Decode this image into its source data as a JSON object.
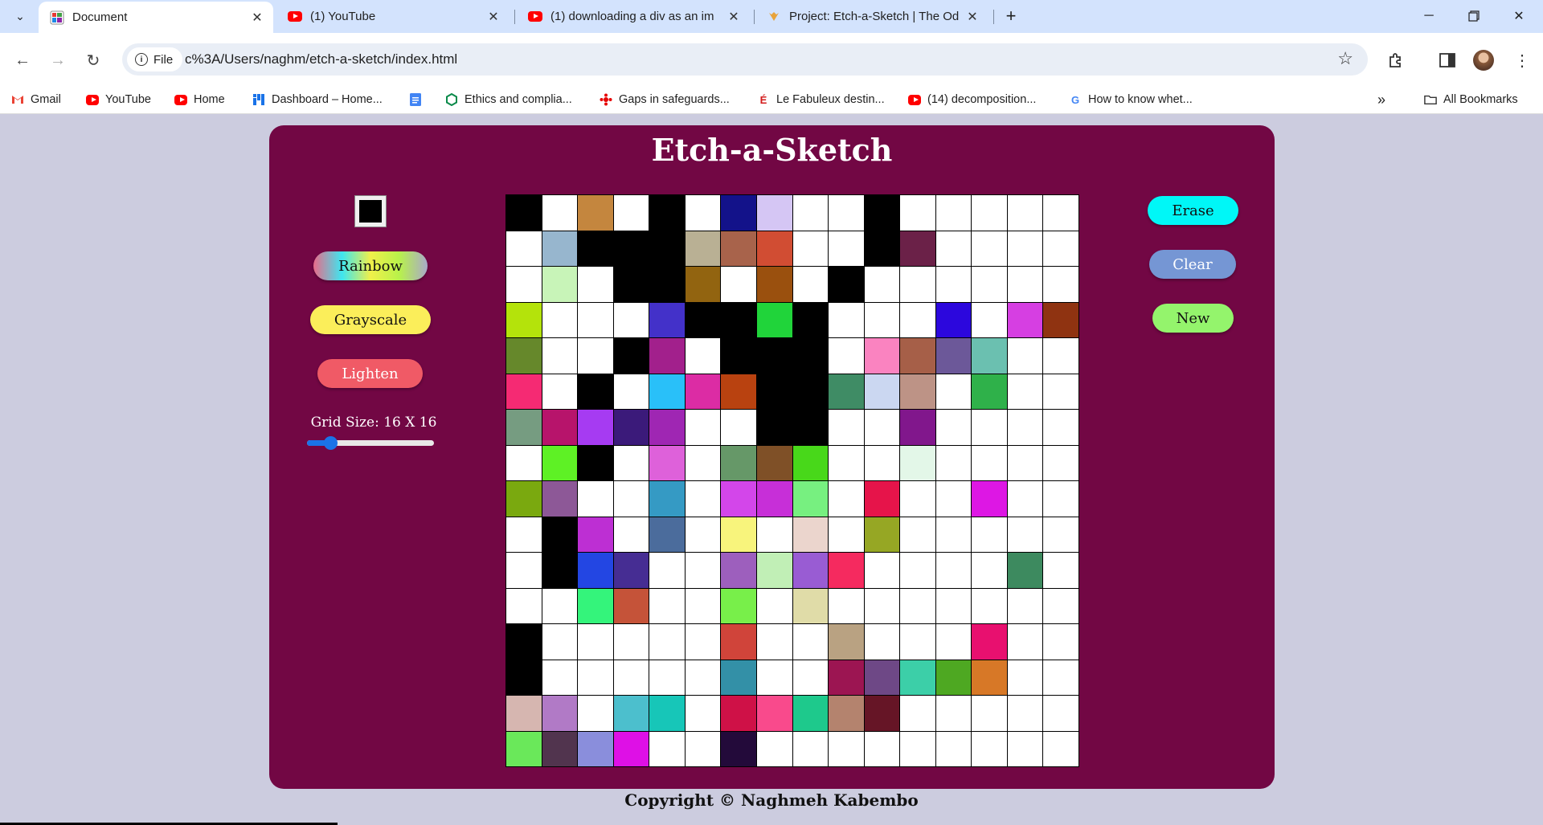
{
  "browser": {
    "tabs": [
      {
        "title": "Document",
        "active": true,
        "icon": "page-favicon"
      },
      {
        "title": "(1) YouTube",
        "active": false,
        "icon": "youtube-favicon"
      },
      {
        "title": "(1) downloading a div as an im",
        "active": false,
        "icon": "youtube-favicon"
      },
      {
        "title": "Project: Etch-a-Sketch | The Od",
        "active": false,
        "icon": "odin-favicon"
      }
    ],
    "file_label": "File",
    "url": "c%3A/Users/naghm/etch-a-sketch/index.html",
    "bookmarks": [
      {
        "label": "Gmail",
        "icon": "gmail-icon"
      },
      {
        "label": "YouTube",
        "icon": "youtube-icon"
      },
      {
        "label": "Home",
        "icon": "youtube-icon"
      },
      {
        "label": "Dashboard – Home...",
        "icon": "dashboard-icon"
      },
      {
        "label": "",
        "icon": "docs-icon"
      },
      {
        "label": "Ethics and complia...",
        "icon": "hexagon-icon"
      },
      {
        "label": "Gaps in safeguards...",
        "icon": "cbc-icon"
      },
      {
        "label": "Le Fabuleux destin...",
        "icon": "e-icon"
      },
      {
        "label": "(14) decomposition...",
        "icon": "youtube-icon"
      },
      {
        "label": "How to know whet...",
        "icon": "google-icon"
      }
    ],
    "all_bookmarks": "All Bookmarks"
  },
  "app": {
    "title": "Etch-a-Sketch",
    "current_color": "#000000",
    "buttons": {
      "rainbow": "Rainbow",
      "grayscale": "Grayscale",
      "lighten": "Lighten",
      "erase": "Erase",
      "clear": "Clear",
      "new": "New"
    },
    "grid_size_label": "Grid Size: 16 X 16",
    "grid_size_value": 16,
    "slider_min": 1,
    "slider_max": 100,
    "grid": [
      [
        "#000000",
        "#ffffff",
        "#c4863e",
        "#ffffff",
        "#000000",
        "#ffffff",
        "#13128a",
        "#d5c6f4",
        "#ffffff",
        "#ffffff",
        "#000000",
        "#ffffff",
        "#ffffff",
        "#ffffff",
        "#ffffff",
        "#ffffff"
      ],
      [
        "#ffffff",
        "#97b6ce",
        "#000000",
        "#000000",
        "#000000",
        "#b9b094",
        "#a8634b",
        "#d14d33",
        "#ffffff",
        "#ffffff",
        "#000000",
        "#6b2148",
        "#ffffff",
        "#ffffff",
        "#ffffff",
        "#ffffff"
      ],
      [
        "#ffffff",
        "#c8f4b8",
        "#ffffff",
        "#000000",
        "#000000",
        "#926410",
        "#ffffff",
        "#9a500e",
        "#ffffff",
        "#000000",
        "#ffffff",
        "#ffffff",
        "#ffffff",
        "#ffffff",
        "#ffffff",
        "#ffffff"
      ],
      [
        "#b4e30b",
        "#ffffff",
        "#ffffff",
        "#ffffff",
        "#4331c9",
        "#000000",
        "#000000",
        "#20d43a",
        "#000000",
        "#ffffff",
        "#ffffff",
        "#ffffff",
        "#2c07dd",
        "#ffffff",
        "#d63fe2",
        "#8f3311"
      ],
      [
        "#66882b",
        "#ffffff",
        "#ffffff",
        "#000000",
        "#a2208c",
        "#ffffff",
        "#000000",
        "#000000",
        "#000000",
        "#ffffff",
        "#fa83c0",
        "#a65f48",
        "#6c5899",
        "#6bc0b0",
        "#ffffff",
        "#ffffff"
      ],
      [
        "#f52a73",
        "#ffffff",
        "#000000",
        "#ffffff",
        "#29c0f9",
        "#dc2ca4",
        "#b94210",
        "#000000",
        "#000000",
        "#3f8c65",
        "#cbd7f1",
        "#bd9386",
        "#ffffff",
        "#2fb14a",
        "#ffffff",
        "#ffffff"
      ],
      [
        "#769c81",
        "#b7146b",
        "#a63bf2",
        "#3b1a7a",
        "#9f26b3",
        "#ffffff",
        "#ffffff",
        "#000000",
        "#000000",
        "#ffffff",
        "#ffffff",
        "#81178c",
        "#ffffff",
        "#ffffff",
        "#ffffff",
        "#ffffff"
      ],
      [
        "#ffffff",
        "#5ef125",
        "#000000",
        "#ffffff",
        "#de61da",
        "#ffffff",
        "#669868",
        "#7f5027",
        "#48d81a",
        "#ffffff",
        "#ffffff",
        "#e3f7e8",
        "#ffffff",
        "#ffffff",
        "#ffffff",
        "#ffffff"
      ],
      [
        "#7aa90f",
        "#8d5897",
        "#ffffff",
        "#ffffff",
        "#359ac4",
        "#ffffff",
        "#d346ea",
        "#c72fd8",
        "#77f080",
        "#ffffff",
        "#e6144a",
        "#ffffff",
        "#ffffff",
        "#dd17e4",
        "#ffffff",
        "#ffffff"
      ],
      [
        "#ffffff",
        "#000000",
        "#bd2fd3",
        "#ffffff",
        "#4b6c9c",
        "#ffffff",
        "#f8f47c",
        "#ffffff",
        "#ebd5cd",
        "#ffffff",
        "#96a724",
        "#ffffff",
        "#ffffff",
        "#ffffff",
        "#ffffff",
        "#ffffff"
      ],
      [
        "#ffffff",
        "#000000",
        "#2346e3",
        "#462d93",
        "#ffffff",
        "#ffffff",
        "#9d5fbd",
        "#c1efb6",
        "#995cd3",
        "#f52a5f",
        "#ffffff",
        "#ffffff",
        "#ffffff",
        "#ffffff",
        "#3d8a5f",
        "#ffffff"
      ],
      [
        "#ffffff",
        "#ffffff",
        "#34f47b",
        "#c55339",
        "#ffffff",
        "#ffffff",
        "#78ef4a",
        "#ffffff",
        "#e0dca8",
        "#ffffff",
        "#ffffff",
        "#ffffff",
        "#ffffff",
        "#ffffff",
        "#ffffff",
        "#ffffff"
      ],
      [
        "#000000",
        "#ffffff",
        "#ffffff",
        "#ffffff",
        "#ffffff",
        "#ffffff",
        "#d0443a",
        "#ffffff",
        "#ffffff",
        "#b9a282",
        "#ffffff",
        "#ffffff",
        "#ffffff",
        "#e8106f",
        "#ffffff",
        "#ffffff"
      ],
      [
        "#000000",
        "#ffffff",
        "#ffffff",
        "#ffffff",
        "#ffffff",
        "#ffffff",
        "#3390a7",
        "#ffffff",
        "#ffffff",
        "#9c1552",
        "#6e4886",
        "#3ccfa8",
        "#4ea822",
        "#d77827",
        "#ffffff",
        "#ffffff"
      ],
      [
        "#d6b6b0",
        "#b17ac6",
        "#ffffff",
        "#4cbfcd",
        "#17c6b8",
        "#ffffff",
        "#cf1147",
        "#f94a8c",
        "#1ec98c",
        "#b4836e",
        "#661526",
        "#ffffff",
        "#ffffff",
        "#ffffff",
        "#ffffff",
        "#ffffff"
      ],
      [
        "#6ae85a",
        "#51344e",
        "#8a8edc",
        "#de10e6",
        "#ffffff",
        "#ffffff",
        "#230a3a",
        "#ffffff",
        "#ffffff",
        "#ffffff",
        "#ffffff",
        "#ffffff",
        "#ffffff",
        "#ffffff",
        "#ffffff",
        "#ffffff"
      ]
    ]
  },
  "footer": {
    "copyright": "Copyright © Naghmeh Kabembo"
  }
}
